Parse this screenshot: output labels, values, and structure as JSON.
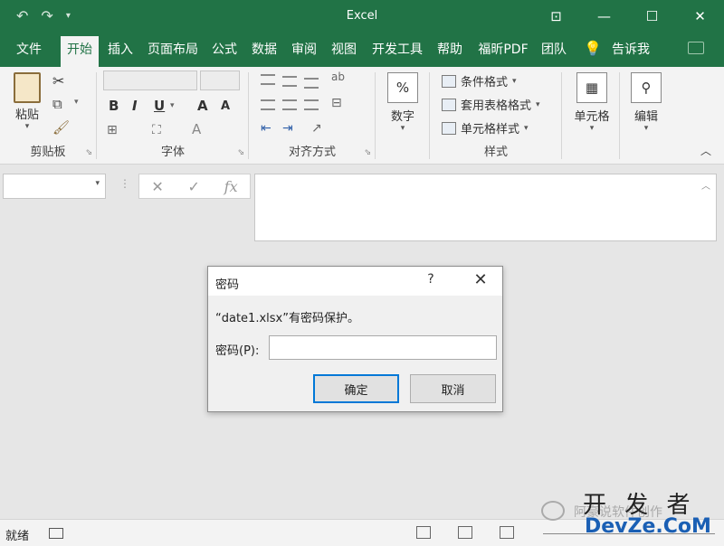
{
  "window": {
    "title": "Excel",
    "undo_icon": "undo-icon",
    "redo_icon": "redo-icon",
    "customize_icon": "customize-qat-icon",
    "controls": [
      "ribbon-display-icon",
      "minimize-icon",
      "maximize-icon",
      "close-icon"
    ]
  },
  "menu": {
    "tabs": [
      "文件",
      "开始",
      "插入",
      "页面布局",
      "公式",
      "数据",
      "审阅",
      "视图",
      "开发工具",
      "帮助",
      "福昕PDF",
      "团队"
    ],
    "active_tab": "开始",
    "tell_me": "告诉我"
  },
  "ribbon": {
    "clipboard": {
      "paste_label": "粘贴",
      "group_label": "剪贴板"
    },
    "font": {
      "bold": "B",
      "italic": "I",
      "underline": "U",
      "grow": "A",
      "shrink": "A",
      "font_color": "A",
      "group_label": "字体"
    },
    "alignment": {
      "group_label": "对齐方式"
    },
    "number": {
      "button_label": "数字",
      "icon": "%"
    },
    "styles": {
      "conditional_format": "条件格式",
      "table_format": "套用表格格式",
      "cell_styles": "单元格样式",
      "group_label": "样式"
    },
    "cells": {
      "button_label": "单元格"
    },
    "editing": {
      "button_label": "编辑"
    }
  },
  "formula_bar": {
    "name_box_value": "",
    "cancel_icon": "✕",
    "enter_icon": "✓",
    "fx_icon": "fx",
    "formula_value": ""
  },
  "dialog": {
    "title": "密码",
    "help": "?",
    "close": "✕",
    "message": "“date1.xlsx”有密码保护。",
    "password_label": "密码(P):",
    "password_value": "",
    "ok_label": "确定",
    "cancel_label": "取消"
  },
  "status": {
    "text": "就绪"
  },
  "watermark": {
    "big_text": "开 发 者",
    "site": "DevZe.CoM",
    "account": "阿豪说软件创作"
  }
}
